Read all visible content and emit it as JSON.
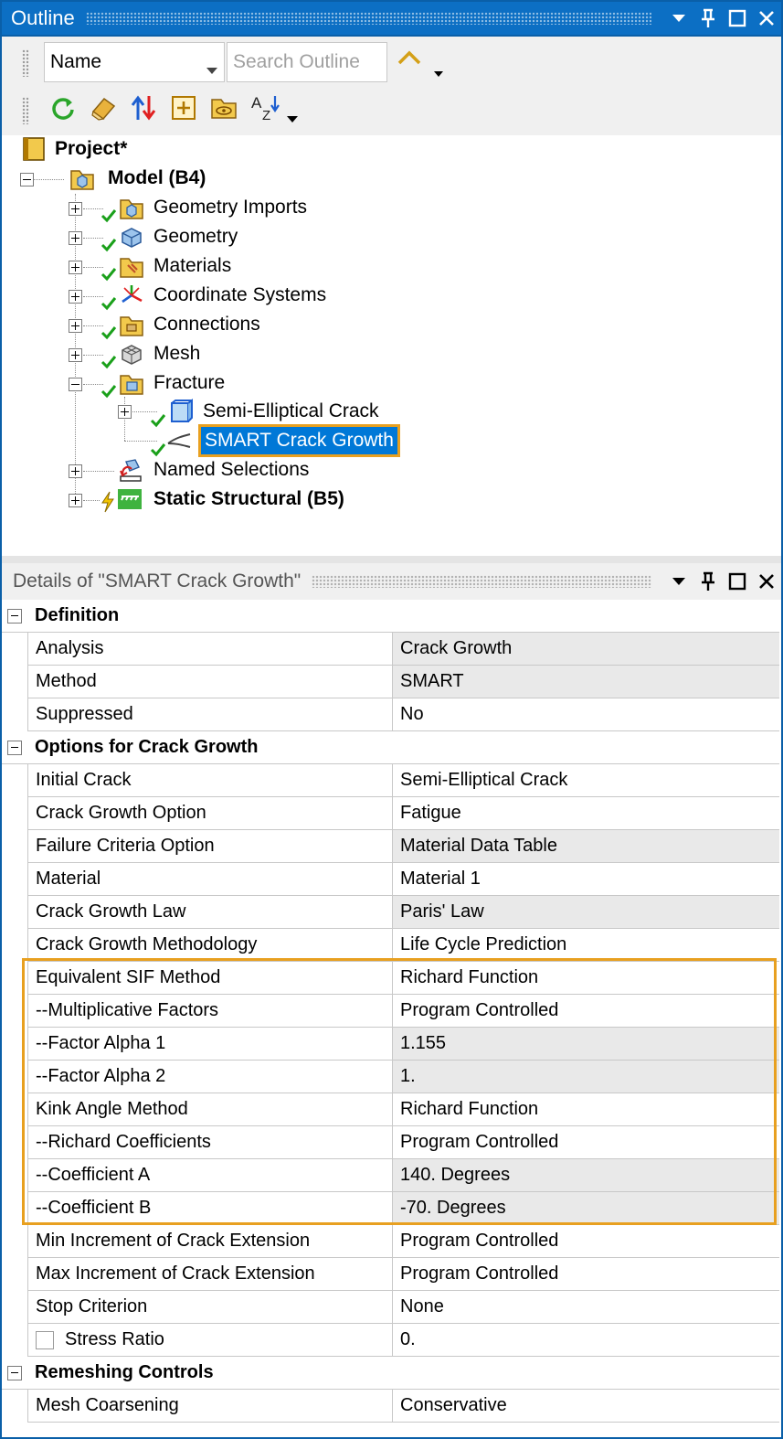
{
  "outline": {
    "title": "Outline",
    "filter_select": "Name",
    "search_placeholder": "Search Outline",
    "tree": {
      "project": "Project*",
      "model": "Model (B4)",
      "children": [
        {
          "label": "Geometry Imports"
        },
        {
          "label": "Geometry"
        },
        {
          "label": "Materials"
        },
        {
          "label": "Coordinate Systems"
        },
        {
          "label": "Connections"
        },
        {
          "label": "Mesh"
        },
        {
          "label": "Fracture"
        },
        {
          "label": "Semi-Elliptical Crack"
        },
        {
          "label": "SMART Crack Growth"
        },
        {
          "label": "Named Selections"
        },
        {
          "label": "Static Structural (B5)"
        }
      ]
    }
  },
  "details": {
    "title": "Details of \"SMART Crack Growth\"",
    "sections": [
      {
        "label": "Definition",
        "rows": [
          {
            "key": "Analysis",
            "value": "Crack Growth"
          },
          {
            "key": "Method",
            "value": "SMART"
          },
          {
            "key": "Suppressed",
            "value": "No"
          }
        ]
      },
      {
        "label": "Options for Crack Growth",
        "rows": [
          {
            "key": "Initial Crack",
            "value": "Semi-Elliptical Crack"
          },
          {
            "key": "Crack Growth Option",
            "value": "Fatigue"
          },
          {
            "key": "Failure Criteria Option",
            "value": "Material Data Table"
          },
          {
            "key": "Material",
            "value": "Material 1"
          },
          {
            "key": "Crack Growth Law",
            "value": "Paris' Law"
          },
          {
            "key": "Crack Growth Methodology",
            "value": "Life Cycle Prediction"
          },
          {
            "key": "Equivalent SIF Method",
            "value": "Richard Function"
          },
          {
            "key": "--Multiplicative Factors",
            "value": "Program Controlled"
          },
          {
            "key": "--Factor Alpha 1",
            "value": "1.155"
          },
          {
            "key": "--Factor Alpha 2",
            "value": "1."
          },
          {
            "key": "Kink Angle Method",
            "value": "Richard Function"
          },
          {
            "key": "--Richard Coefficients",
            "value": "Program Controlled"
          },
          {
            "key": "--Coefficient A",
            "value": "140. Degrees"
          },
          {
            "key": "--Coefficient B",
            "value": "-70. Degrees"
          },
          {
            "key": "Min Increment of Crack Extension",
            "value": "Program Controlled"
          },
          {
            "key": "Max Increment of Crack Extension",
            "value": "Program Controlled"
          },
          {
            "key": "Stop Criterion",
            "value": "None"
          },
          {
            "key": "Stress Ratio",
            "value": "0."
          }
        ]
      },
      {
        "label": "Remeshing Controls",
        "rows": [
          {
            "key": "Mesh Coarsening",
            "value": "Conservative"
          }
        ]
      }
    ]
  },
  "colors": {
    "titlebar": "#0c6fc4",
    "selection": "#0078d7",
    "highlight": "#e8a020",
    "check": "#1aa01a"
  }
}
